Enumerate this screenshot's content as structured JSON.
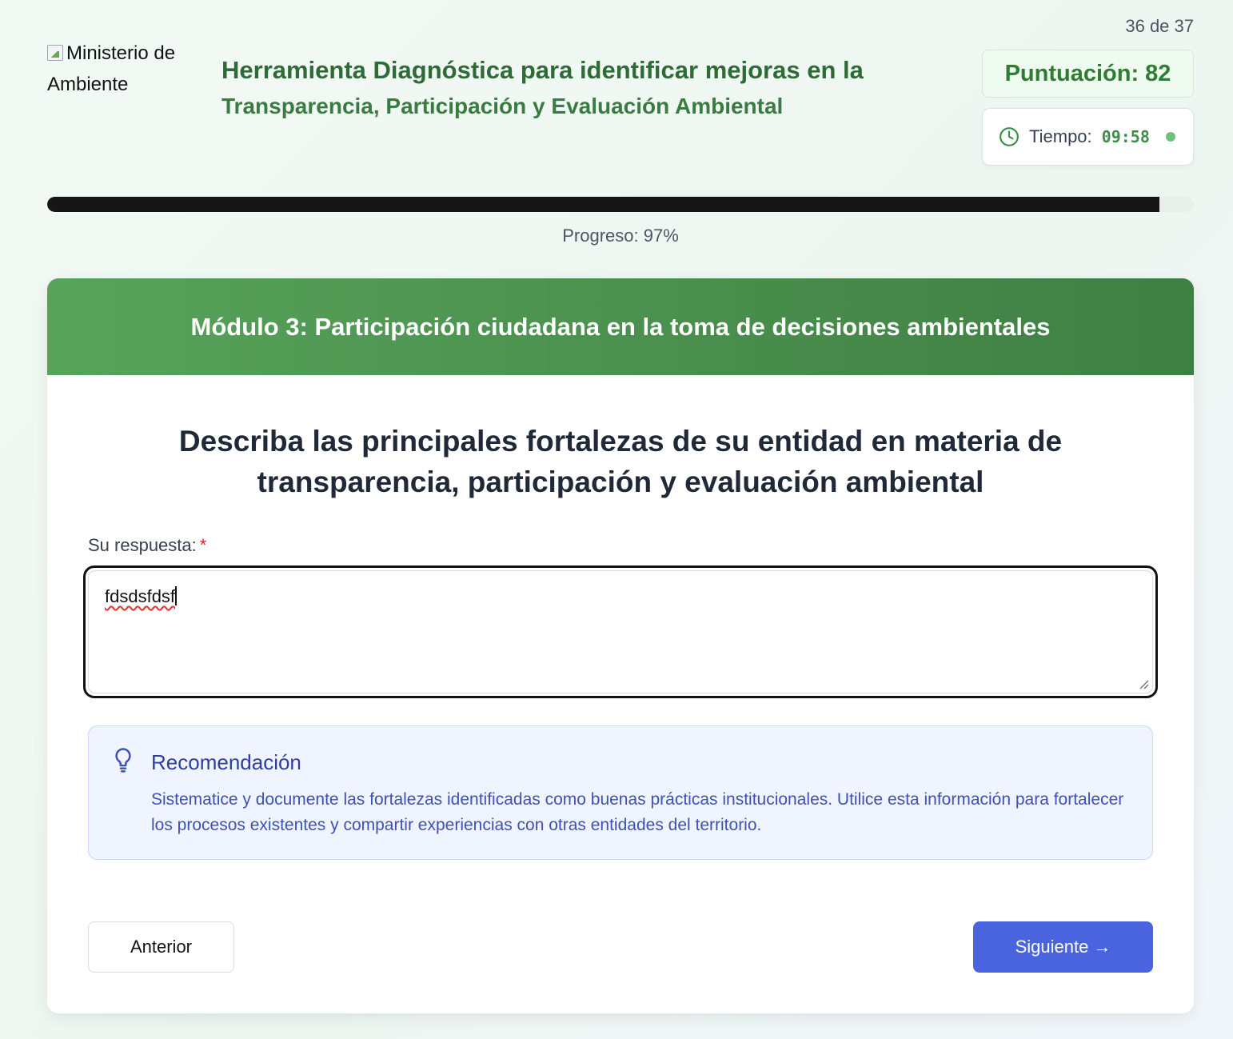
{
  "header": {
    "logo_alt": "Ministerio de Ambiente",
    "title_line1": "Herramienta Diagnóstica para identificar mejoras en la",
    "title_line2": "Transparencia, Participación y Evaluación Ambiental",
    "question_counter": "36 de 37",
    "score_label": "Puntuación: 82",
    "time_label": "Tiempo:",
    "time_value": "09:58"
  },
  "progress": {
    "value_percent": 97,
    "label": "Progreso: 97%"
  },
  "module": {
    "title": "Módulo 3: Participación ciudadana en la toma de decisiones ambientales"
  },
  "question": {
    "text": "Describa las principales fortalezas de su entidad en materia de transparencia, participación y evaluación ambiental",
    "answer_label": "Su respuesta:",
    "required_mark": "*",
    "answer_value": "fdsdsfdsf"
  },
  "recommendation": {
    "title": "Recomendación",
    "text": "Sistematice y documente las fortalezas identificadas como buenas prácticas institucionales. Utilice esta información para fortalecer los procesos existentes y compartir experiencias con otras entidades del territorio."
  },
  "navigation": {
    "prev_label": "Anterior",
    "next_label": "Siguiente →"
  },
  "colors": {
    "brand_green": "#2e6b36",
    "header_gradient_start": "#58a35a",
    "header_gradient_end": "#3f7f44",
    "primary_button": "#4a63df",
    "recommendation_bg": "#eff4fe",
    "recommendation_text": "#3f51b5",
    "timer_green": "#3c8e49",
    "required_red": "#dc2626"
  },
  "icons": {
    "logo": "broken-image-icon",
    "timer": "clock-icon",
    "status": "status-dot-icon",
    "recommendation": "lightbulb-icon",
    "textarea": "resize-grip-icon"
  }
}
